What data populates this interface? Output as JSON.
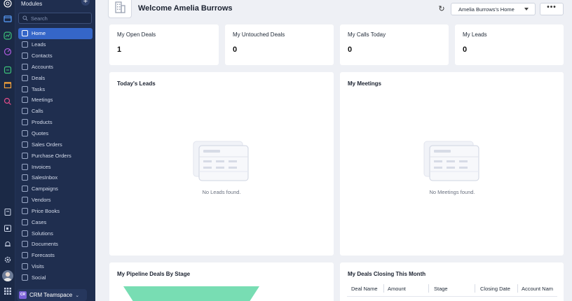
{
  "sidebar": {
    "title": "Modules",
    "search_placeholder": "Search",
    "items": [
      {
        "label": "Home"
      },
      {
        "label": "Leads"
      },
      {
        "label": "Contacts"
      },
      {
        "label": "Accounts"
      },
      {
        "label": "Deals"
      },
      {
        "label": "Tasks"
      },
      {
        "label": "Meetings"
      },
      {
        "label": "Calls"
      },
      {
        "label": "Products"
      },
      {
        "label": "Quotes"
      },
      {
        "label": "Sales Orders"
      },
      {
        "label": "Purchase Orders"
      },
      {
        "label": "Invoices"
      },
      {
        "label": "SalesInbox"
      },
      {
        "label": "Campaigns"
      },
      {
        "label": "Vendors"
      },
      {
        "label": "Price Books"
      },
      {
        "label": "Cases"
      },
      {
        "label": "Solutions"
      },
      {
        "label": "Documents"
      },
      {
        "label": "Forecasts"
      },
      {
        "label": "Visits"
      },
      {
        "label": "Social"
      }
    ],
    "active_item": "Home",
    "teamspace": {
      "badge": "CR",
      "label": "CRM Teamspace"
    }
  },
  "header": {
    "welcome": "Welcome Amelia Burrows",
    "home_select": "Amelia Burrows's Home",
    "more": "•••"
  },
  "stats": [
    {
      "label": "My Open Deals",
      "value": "1"
    },
    {
      "label": "My Untouched Deals",
      "value": "0"
    },
    {
      "label": "My Calls Today",
      "value": "0"
    },
    {
      "label": "My Leads",
      "value": "0"
    }
  ],
  "panels": {
    "leads": {
      "title": "Today's Leads",
      "empty": "No Leads found."
    },
    "meetings": {
      "title": "My Meetings",
      "empty": "No Meetings found."
    },
    "pipeline": {
      "title": "My Pipeline Deals By Stage"
    },
    "closing": {
      "title": "My Deals Closing This Month",
      "columns": [
        "Deal Name",
        "Amount",
        "Stage",
        "Closing Date",
        "Account Nam"
      ]
    }
  },
  "colors": {
    "sidebar_bg": "#1f2e4f",
    "rail_bg": "#1b2946",
    "active_item": "#3566c8",
    "funnel": "#78ddb3",
    "teamspace_badge": "#7b61d9"
  }
}
